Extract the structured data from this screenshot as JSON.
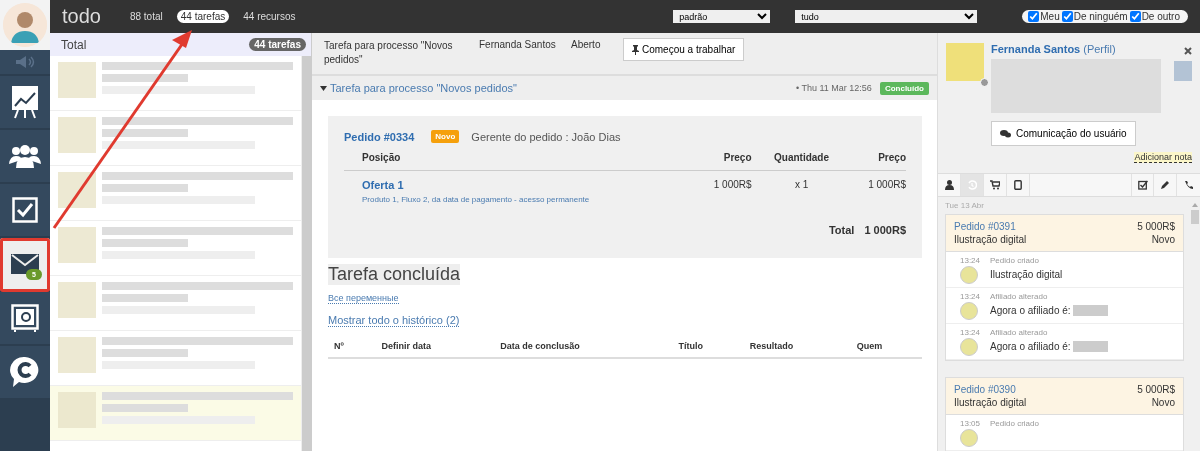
{
  "sidebar": {
    "items": [
      {
        "kind": "sound",
        "selected": false
      },
      {
        "kind": "chart",
        "selected": false
      },
      {
        "kind": "people",
        "selected": false
      },
      {
        "kind": "check",
        "selected": false
      },
      {
        "kind": "mail",
        "selected": true,
        "badge": "5"
      },
      {
        "kind": "safe",
        "selected": false
      },
      {
        "kind": "chat",
        "selected": false
      }
    ]
  },
  "topbar": {
    "title": "todo",
    "filters": [
      {
        "label": "88 total",
        "selected": false
      },
      {
        "label": "44 tarefas",
        "selected": true
      },
      {
        "label": "44 recursos",
        "selected": false
      }
    ],
    "selects": [
      {
        "value": "padrão"
      },
      {
        "value": "tudo"
      }
    ],
    "checkboxes": [
      {
        "label": "Meu",
        "checked": true
      },
      {
        "label": "De ninguém",
        "checked": true
      },
      {
        "label": "De outro",
        "checked": true
      }
    ]
  },
  "list": {
    "title": "Total",
    "badge": "44 tarefas",
    "rows": [
      {
        "highlighted": false
      },
      {
        "highlighted": false
      },
      {
        "highlighted": false
      },
      {
        "highlighted": false
      },
      {
        "highlighted": false
      },
      {
        "highlighted": false
      },
      {
        "highlighted": true
      }
    ]
  },
  "task": {
    "header": {
      "title": "Tarefa para processo \"Novos pedidos\"",
      "assignee": "Fernanda Santos",
      "status": "Aberto",
      "button": "Começou a trabalhar"
    },
    "section": {
      "title": "Tarefa para processo \"Novos pedidos\"",
      "expanded": true,
      "date": "• Thu 11 Mar 12:56",
      "status": "Concluído"
    },
    "order": {
      "title": "Pedido #0334",
      "badge": "Novo",
      "manager": "Gerente do pedido : João Dias",
      "columns": [
        "Posição",
        "Preço",
        "Quantidade",
        "Preço"
      ],
      "items": [
        {
          "name": "Oferta 1",
          "description": "Produto 1, Fluxo 2, da data de pagamento - acesso permanente",
          "price": "1 000R$",
          "quantity": "x 1",
          "total": "1 000R$"
        }
      ],
      "total_label": "Total",
      "total": "1 000R$"
    },
    "result_title": "Tarefa concluída",
    "variables_link": "Все переменные",
    "history_link": "Mostrar todo o histórico (2)",
    "history_columns": [
      "Nº",
      "Definir data",
      "Data de conclusão",
      "Título",
      "Resultado",
      "Quem"
    ]
  },
  "profile": {
    "name": "Fernanda Santos",
    "profile_link": "(Perfil)",
    "button": "Comunicação do usuário",
    "note_link": "Adicionar nota",
    "tabs": [
      {
        "kind": "user",
        "selected": false
      },
      {
        "kind": "history",
        "selected": true
      },
      {
        "kind": "cart",
        "selected": false
      },
      {
        "kind": "tablet",
        "selected": false
      },
      {
        "kind": "check",
        "selected": false
      },
      {
        "kind": "pencil",
        "selected": false
      },
      {
        "kind": "phone",
        "selected": false
      }
    ]
  },
  "timeline": {
    "date": "Tue 13 Abr",
    "orders": [
      {
        "title": "Pedido #0391",
        "amount": "5 000R$",
        "product": "Ilustração digital",
        "status": "Novo",
        "events": [
          {
            "time": "13:24",
            "title": "Pedido criado",
            "text": "Ilustração digital",
            "redacted": false
          },
          {
            "time": "13:24",
            "title": "Afiliado alterado",
            "text": "Agora o afiliado é:",
            "redacted": true
          },
          {
            "time": "13:24",
            "title": "Afiliado alterado",
            "text": "Agora o afiliado é:",
            "redacted": true
          }
        ]
      },
      {
        "title": "Pedido #0390",
        "amount": "5 000R$",
        "product": "Ilustração digital",
        "status": "Novo",
        "events": [
          {
            "time": "13:05",
            "title": "Pedido criado"
          }
        ]
      }
    ]
  }
}
